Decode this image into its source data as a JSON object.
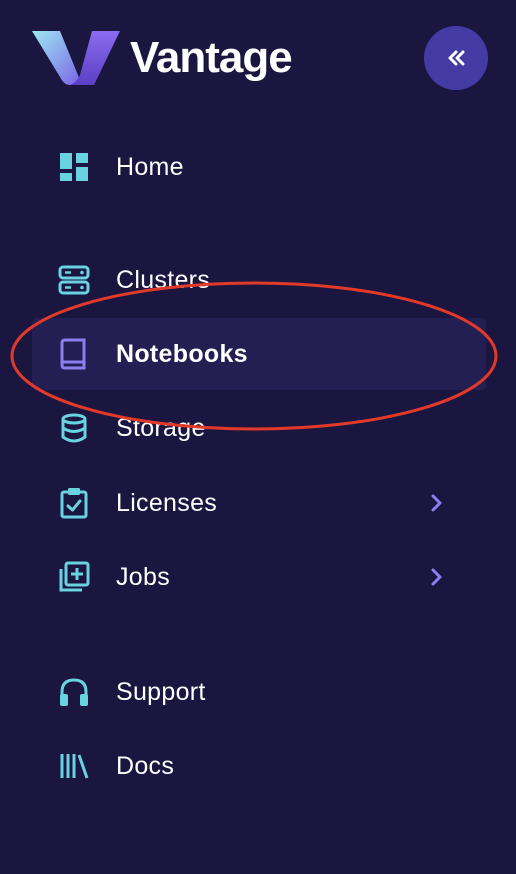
{
  "brand": {
    "name": "Vantage",
    "logo_icon": "vantage-v-logo"
  },
  "header": {
    "collapse_icon": "double-chevron-left-icon"
  },
  "colors": {
    "background": "#1a1640",
    "active_item_bg": "#231f52",
    "icon_teal": "#69d3e0",
    "icon_purple": "#8b7ff0",
    "collapse_button": "#453ba4",
    "annotation_red": "#e23a2a"
  },
  "nav": {
    "items": [
      {
        "label": "Home",
        "icon": "dashboard-grid-icon",
        "active": false,
        "has_children": false
      },
      {
        "label": "Clusters",
        "icon": "server-icon",
        "active": false,
        "has_children": false
      },
      {
        "label": "Notebooks",
        "icon": "book-icon",
        "active": true,
        "has_children": false
      },
      {
        "label": "Storage",
        "icon": "database-icon",
        "active": false,
        "has_children": false
      },
      {
        "label": "Licenses",
        "icon": "clipboard-check-icon",
        "active": false,
        "has_children": true
      },
      {
        "label": "Jobs",
        "icon": "add-library-icon",
        "active": false,
        "has_children": true
      },
      {
        "label": "Support",
        "icon": "headphones-icon",
        "active": false,
        "has_children": false
      },
      {
        "label": "Docs",
        "icon": "library-books-icon",
        "active": false,
        "has_children": false
      }
    ]
  }
}
